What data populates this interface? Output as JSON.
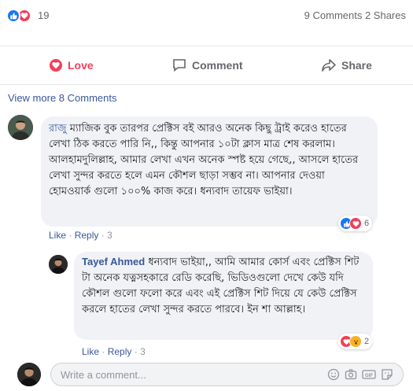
{
  "summary": {
    "reaction_count": "19",
    "comments_shares": "9 Comments 2 Shares",
    "reactions": [
      "like-icon",
      "love-icon"
    ]
  },
  "actions": {
    "love": "Love",
    "comment": "Comment",
    "share": "Share"
  },
  "view_more": "View more 8 Comments",
  "comments": [
    {
      "author": "রাজু",
      "text": "ম্যাজিক বুক তারপর প্রেক্টিস বই আরও অনেক কিছু ট্রাই করেও হাতের লেখা ঠিক করতে পারি নি,, কিন্তু আপনার ১০টা ক্লাস মাত্র শেষ করলাম। আলহামদুলিল্লাহ, আমার লেখা এখন অনেক স্পষ্ট হয়ে গেছে,, আসলে হাতের লেখা সুন্দর করতে হলে এমন কৌশল ছাড়া সম্ভব না। আপনার দেওয়া হোমওয়ার্ক গুলো ১০০% কাজ করে। ধন্যবাদ তায়েফ ভাইয়া।",
      "like": "Like",
      "reply": "Reply",
      "time": "3",
      "reaction_count": "6",
      "reactions": [
        "like-icon",
        "love-icon"
      ]
    },
    {
      "author": "Tayef Ahmed",
      "text": "ধন্যবাদ ভাইয়া,, আমি আমার কোর্স এবং প্রেক্টিস শিট টা অনেক যত্নসহকারে রেডি করেছি, ভিডিওগুলো দেখে কেউ যদি কৌশল গুলো ফলো করে এবং এই প্রেক্টিস শিট দিয়ে যে কেউ প্রেক্টিস করলে হাতের লেখা সুন্দর করতে পারবে। ইন শা আল্লাহ।",
      "like": "Like",
      "reply": "Reply",
      "time": "3",
      "reaction_count": "2",
      "reactions": [
        "love-icon",
        "wow-icon"
      ]
    }
  ],
  "composer": {
    "placeholder": "Write a comment...",
    "tools": [
      "emoji-icon",
      "camera-icon",
      "gif-icon",
      "sticker-icon"
    ]
  },
  "colors": {
    "link": "#385898",
    "love": "#f33e58",
    "like": "#1877f2",
    "muted": "#65676b"
  }
}
